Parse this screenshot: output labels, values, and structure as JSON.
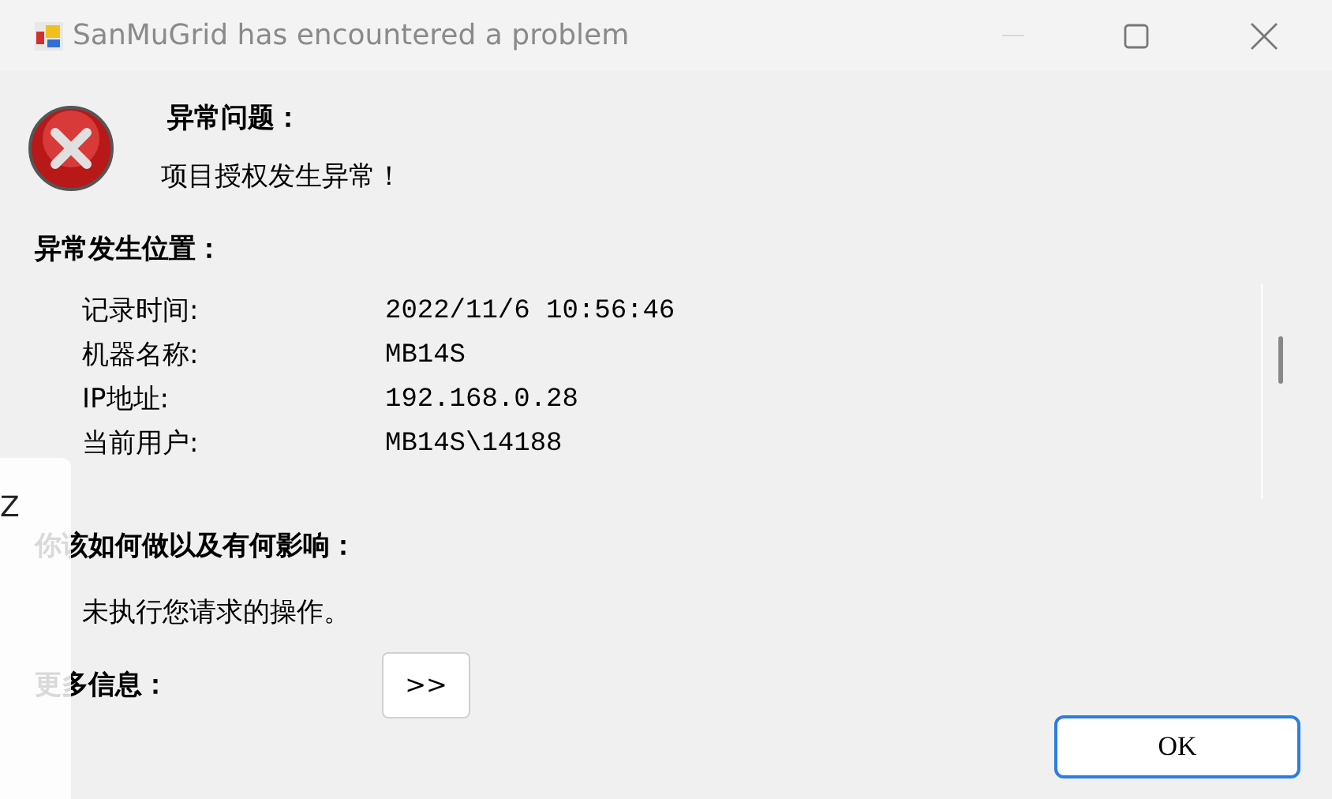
{
  "window": {
    "title": "SanMuGrid has encountered a problem"
  },
  "problem": {
    "heading": "异常问题：",
    "message": "项目授权发生异常！"
  },
  "location": {
    "heading": "异常发生位置：",
    "rows": [
      {
        "label": "记录时间:",
        "value": "2022/11/6 10:56:46"
      },
      {
        "label": "机器名称:",
        "value": "MB14S"
      },
      {
        "label": "IP地址:",
        "value": "192.168.0.28"
      },
      {
        "label": "当前用户:",
        "value": "MB14S\\14188"
      }
    ]
  },
  "impact": {
    "heading": "你该如何做以及有何影响：",
    "text": "未执行您请求的操作。"
  },
  "more_info": {
    "heading": "更多信息：",
    "button": ">>"
  },
  "ok_button": "OK",
  "overlay_window": {
    "text": "Z"
  }
}
